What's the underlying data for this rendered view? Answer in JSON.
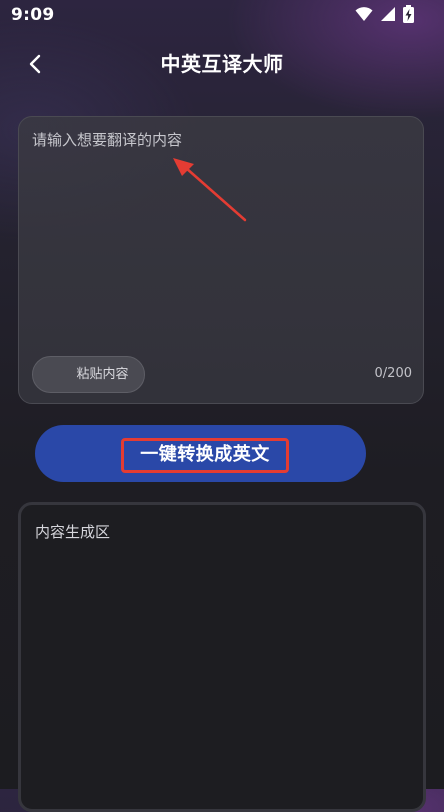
{
  "status_bar": {
    "time": "9:09",
    "icons": [
      "wifi-icon",
      "signal-icon",
      "battery-charging-icon"
    ]
  },
  "header": {
    "title": "中英互译大师",
    "back_icon": "chevron-left-icon"
  },
  "input": {
    "placeholder": "请输入想要翻译的内容",
    "value": "",
    "paste_label": "粘贴内容",
    "counter": "0/200"
  },
  "convert": {
    "label": "一键转换成英文"
  },
  "output": {
    "placeholder": "内容生成区"
  },
  "colors": {
    "accent_button": "#2a48a8",
    "annotation_red": "#e43c33",
    "card_border": "#4a4a52"
  }
}
